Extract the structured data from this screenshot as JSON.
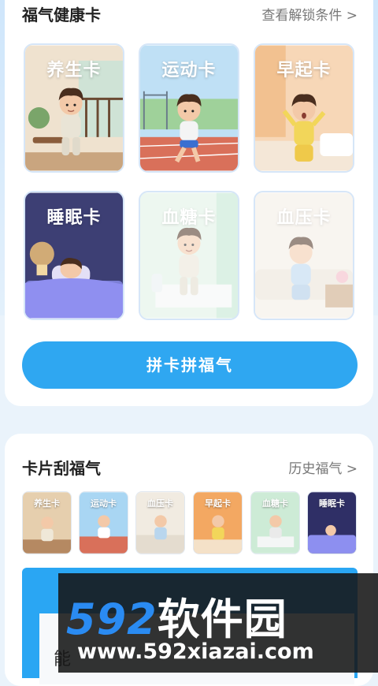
{
  "section1": {
    "title": "福气健康卡",
    "link": "查看解锁条件 >",
    "cards": [
      {
        "label": "养生卡",
        "icon": "tea-balcony-icon"
      },
      {
        "label": "运动卡",
        "icon": "running-track-icon"
      },
      {
        "label": "早起卡",
        "icon": "morning-bedroom-icon"
      },
      {
        "label": "睡眠卡",
        "icon": "sleeping-bed-icon"
      },
      {
        "label": "血糖卡",
        "icon": "glucose-meter-icon"
      },
      {
        "label": "血压卡",
        "icon": "blood-pressure-icon"
      }
    ],
    "button": "拼卡拼福气"
  },
  "section2": {
    "title": "卡片刮福气",
    "link": "历史福气 >",
    "minis": [
      {
        "label": "养生卡"
      },
      {
        "label": "运动卡"
      },
      {
        "label": "血压卡"
      },
      {
        "label": "早起卡"
      },
      {
        "label": "血糖卡"
      },
      {
        "label": "睡眠卡"
      }
    ],
    "inner_char": "能"
  },
  "watermark": {
    "big_digits": "592",
    "big_text": "软件园",
    "url": "www.592xiazai.com"
  },
  "colors": {
    "accent": "#2fa7f1",
    "watermark_blue": "#2a8bf2"
  }
}
